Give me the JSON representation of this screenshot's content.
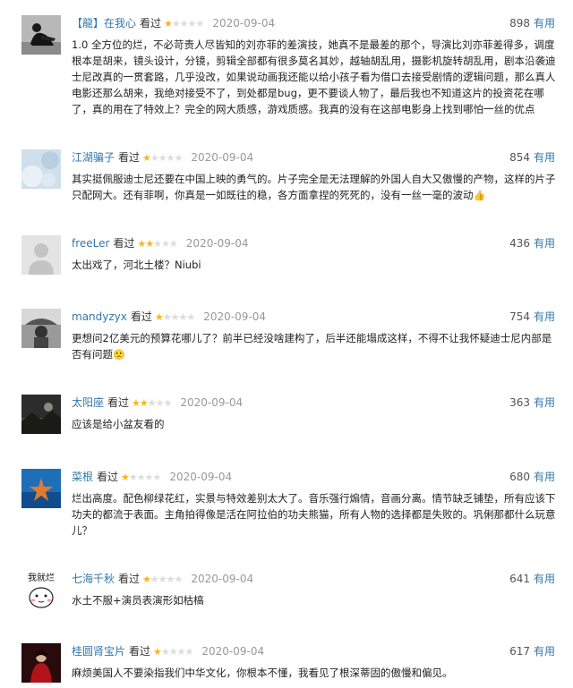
{
  "reviews": [
    {
      "username": "【龍】在我心",
      "seen_label": "看过",
      "rating": 1,
      "date": "2020-09-04",
      "votes": "898",
      "useful_label": "有用",
      "content": "1.0 全方位的烂，不必苛责人尽皆知的刘亦菲的差演技，她真不是最差的那个，导演比刘亦菲差得多，调度根本是胡来，镜头设计，分镜，剪辑全部都有很多莫名其妙，越轴胡乱用，摄影机旋转胡乱用，剧本沿袭迪士尼改真的一贯套路，几乎没改，如果说动画我还能以给小孩子看为借口去接受剧情的逻辑问题，那么真人电影还那么胡来，我绝对接受不了，到处都是bug，更不要谈人物了，最后我也不知道这片的投资花在哪了，真的用在了特效上？完全的网大质感，游戏质感。我真的没有在这部电影身上找到哪怕一丝的优点",
      "avatar_icon": "person-sitting-dark-photo"
    },
    {
      "username": "江湖骗子",
      "seen_label": "看过",
      "rating": 1,
      "date": "2020-09-04",
      "votes": "854",
      "useful_label": "有用",
      "content": "其实挺佩服迪士尼还要在中国上映的勇气的。片子完全是无法理解的外国人自大又傲慢的产物，这样的片子只配网大。还有菲啊，你真是一如既往的稳，各方面拿捏的死死的，没有一丝一毫的波动",
      "content_emoji": "👍",
      "avatar_icon": "pale-blue-blur-photo"
    },
    {
      "username": "freeLer",
      "seen_label": "看过",
      "rating": 2,
      "date": "2020-09-04",
      "votes": "436",
      "useful_label": "有用",
      "content": "太出戏了，河北土楼？Niubi",
      "avatar_icon": "default-user-icon"
    },
    {
      "username": "mandyzyx",
      "seen_label": "看过",
      "rating": 1,
      "date": "2020-09-04",
      "votes": "754",
      "useful_label": "有用",
      "content": "更想问2亿美元的预算花哪儿了？前半已经没啥建构了，后半还能塌成这样，不得不让我怀疑迪士尼内部是否有问题",
      "content_emoji": "🙁",
      "avatar_icon": "grayscale-photo"
    },
    {
      "username": "太阳座",
      "seen_label": "看过",
      "rating": 2,
      "date": "2020-09-04",
      "votes": "363",
      "useful_label": "有用",
      "content": "应该是给小盆友看的",
      "avatar_icon": "dark-landscape-photo"
    },
    {
      "username": "菜根",
      "seen_label": "看过",
      "rating": 1,
      "date": "2020-09-04",
      "votes": "680",
      "useful_label": "有用",
      "content": "烂出高度。配色柳绿花红，实景与特效差别太大了。音乐强行煽情，音画分离。情节缺乏铺垫，所有应该下功夫的都流于表面。主角拍得像是活在阿拉伯的功夫熊猫，所有人物的选择都是失败的。巩俐那都什么玩意儿？",
      "avatar_icon": "blue-sea-starfish-photo"
    },
    {
      "username": "七海千秋",
      "seen_label": "看过",
      "rating": 1,
      "date": "2020-09-04",
      "votes": "641",
      "useful_label": "有用",
      "content": "水土不服+演员表演形如枯槁",
      "avatar_icon": "cartoon-sticker",
      "avatar_text": "我就烂"
    },
    {
      "username": "桂圆肾宝片",
      "seen_label": "看过",
      "rating": 1,
      "date": "2020-09-04",
      "votes": "617",
      "useful_label": "有用",
      "content": "麻烦美国人不要染指我们中华文化，你根本不懂，我看见了根深蒂固的傲慢和偏见。",
      "avatar_icon": "red-portrait-photo"
    }
  ]
}
